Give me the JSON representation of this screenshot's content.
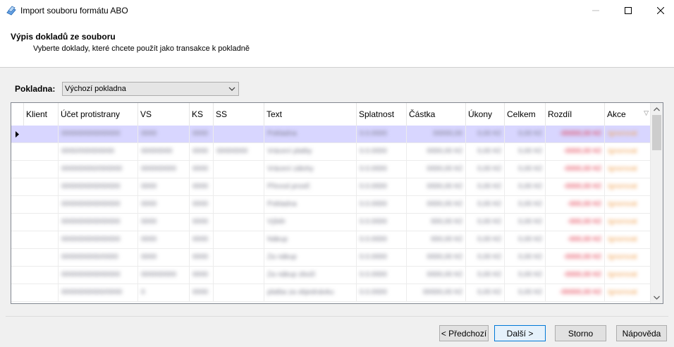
{
  "window": {
    "title": "Import souboru formátu ABO"
  },
  "header": {
    "title": "Výpis dokladů ze souboru",
    "subtitle": "Vyberte doklady, které chcete použít jako transakce k pokladně"
  },
  "pokladna": {
    "label": "Pokladna:",
    "selected": "Výchozí pokladna"
  },
  "grid": {
    "columns": [
      "Klient",
      "Účet protistrany",
      "VS",
      "KS",
      "SS",
      "Text",
      "Splatnost",
      "Částka",
      "Úkony",
      "Celkem",
      "Rozdíl",
      "Akce"
    ],
    "rows": [
      {
        "ucet": "000000000000000",
        "vs": "0000",
        "ks": "0000",
        "ss": "",
        "text": "Pokladna",
        "splatnost": "0.0.0000",
        "castka": "00000,00",
        "ukony": "0,00 Kč",
        "celkem": "0,00 Kč",
        "rozdil": "-00000,00 Kč",
        "akce": "Ignorovat"
      },
      {
        "ucet": "0000/000000000",
        "vs": "00000000",
        "ks": "0000",
        "ss": "00000000",
        "text": "Vrácení platby",
        "splatnost": "0.0.0000",
        "castka": "0000,00 Kč",
        "ukony": "0,00 Kč",
        "celkem": "0,00 Kč",
        "rozdil": "-0000,00 Kč",
        "akce": "Ignorovat"
      },
      {
        "ucet": "000000000/000000",
        "vs": "000000000",
        "ks": "0000",
        "ss": "",
        "text": "Vrácení zálohy",
        "splatnost": "0.0.0000",
        "castka": "0000,00 Kč",
        "ukony": "0,00 Kč",
        "celkem": "0,00 Kč",
        "rozdil": "-0000,00 Kč",
        "akce": "Ignorovat"
      },
      {
        "ucet": "000000000000000",
        "vs": "0000",
        "ks": "0000",
        "ss": "",
        "text": "Převod prostř.",
        "splatnost": "0.0.0000",
        "castka": "0000,00 Kč",
        "ukony": "0,00 Kč",
        "celkem": "0,00 Kč",
        "rozdil": "-0000,00 Kč",
        "akce": "Ignorovat"
      },
      {
        "ucet": "000000000000000",
        "vs": "0000",
        "ks": "0000",
        "ss": "",
        "text": "Pokladna",
        "splatnost": "0.0.0000",
        "castka": "0000,00 Kč",
        "ukony": "0,00 Kč",
        "celkem": "0,00 Kč",
        "rozdil": "-000,00 Kč",
        "akce": "Ignorovat"
      },
      {
        "ucet": "000000000000000",
        "vs": "0000",
        "ks": "0000",
        "ss": "",
        "text": "Výběr",
        "splatnost": "0.0.0000",
        "castka": "000,00 Kč",
        "ukony": "0,00 Kč",
        "celkem": "0,00 Kč",
        "rozdil": "-000,00 Kč",
        "akce": "Ignorovat"
      },
      {
        "ucet": "000000000000000",
        "vs": "0000",
        "ks": "0000",
        "ss": "",
        "text": "Nákup",
        "splatnost": "0.0.0000",
        "castka": "000,00 Kč",
        "ukony": "0,00 Kč",
        "celkem": "0,00 Kč",
        "rozdil": "-000,00 Kč",
        "akce": "Ignorovat"
      },
      {
        "ucet": "0000000000/0000",
        "vs": "0000",
        "ks": "0000",
        "ss": "",
        "text": "Za nákup",
        "splatnost": "0.0.0000",
        "castka": "0000,00 Kč",
        "ukony": "0,00 Kč",
        "celkem": "0,00 Kč",
        "rozdil": "-0000,00 Kč",
        "akce": "Ignorovat"
      },
      {
        "ucet": "000000000000000",
        "vs": "000000000",
        "ks": "0000",
        "ss": "",
        "text": "Za nákup zboží",
        "splatnost": "0.0.0000",
        "castka": "0000,00 Kč",
        "ukony": "0,00 Kč",
        "celkem": "0,00 Kč",
        "rozdil": "-0000,00 Kč",
        "akce": "Ignorovat"
      },
      {
        "ucet": "00000000000/0000",
        "vs": "0",
        "ks": "0000",
        "ss": "",
        "text": "platba za objednávku",
        "splatnost": "0.0.0000",
        "castka": "00000,00 Kč",
        "ukony": "0,00 Kč",
        "celkem": "0,00 Kč",
        "rozdil": "-00000,00 Kč",
        "akce": "Ignorovat"
      }
    ]
  },
  "buttons": {
    "prev": "< Předchozí",
    "next": "Další >",
    "cancel": "Storno",
    "help": "Nápověda"
  }
}
